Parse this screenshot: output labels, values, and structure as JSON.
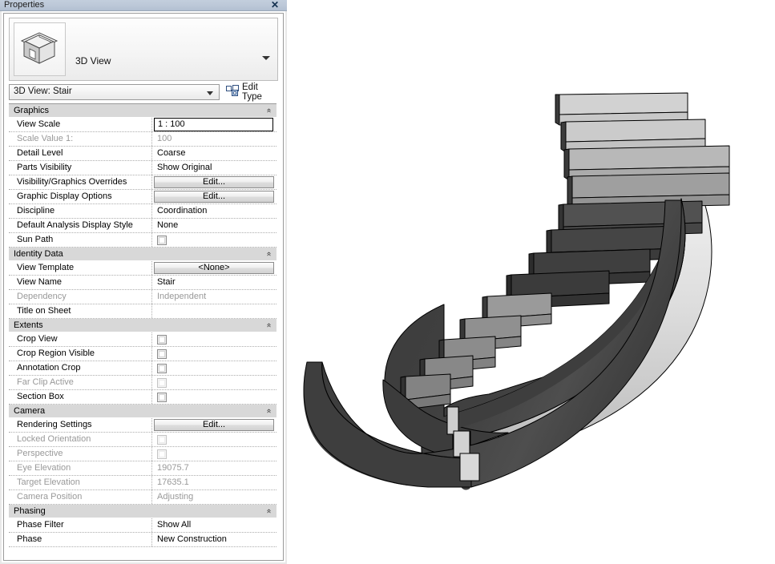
{
  "palette": {
    "title": "Properties",
    "close_icon": "close-icon",
    "type_thumbnail_icon": "house-3d-icon",
    "type_name": "3D View",
    "type_caret_icon": "chevron-down-icon",
    "type_selector_value": "3D View: Stair",
    "type_selector_arrow_icon": "chevron-down-icon",
    "edit_type_label": "Edit Type",
    "edit_type_icon": "edit-type-icon"
  },
  "sections": [
    {
      "name": "Graphics",
      "collapse_icon": "chevron-double-up-icon",
      "rows": [
        {
          "label": "View Scale",
          "type": "active-text",
          "value": "1 : 100",
          "disabled": false
        },
        {
          "label": "Scale Value    1:",
          "type": "text",
          "value": "100",
          "disabled": true
        },
        {
          "label": "Detail Level",
          "type": "text",
          "value": "Coarse",
          "disabled": false
        },
        {
          "label": "Parts Visibility",
          "type": "text",
          "value": "Show Original",
          "disabled": false
        },
        {
          "label": "Visibility/Graphics Overrides",
          "type": "button",
          "value": "Edit...",
          "disabled": false
        },
        {
          "label": "Graphic Display Options",
          "type": "button",
          "value": "Edit...",
          "disabled": false
        },
        {
          "label": "Discipline",
          "type": "text",
          "value": "Coordination",
          "disabled": false
        },
        {
          "label": "Default Analysis Display Style",
          "type": "text",
          "value": "None",
          "disabled": false
        },
        {
          "label": "Sun Path",
          "type": "checkbox",
          "value": "",
          "checked": false,
          "disabled": false
        }
      ]
    },
    {
      "name": "Identity Data",
      "collapse_icon": "chevron-double-up-icon",
      "rows": [
        {
          "label": "View Template",
          "type": "button",
          "value": "<None>",
          "disabled": false
        },
        {
          "label": "View Name",
          "type": "text",
          "value": "Stair",
          "disabled": false
        },
        {
          "label": "Dependency",
          "type": "text",
          "value": "Independent",
          "disabled": true
        },
        {
          "label": "Title on Sheet",
          "type": "text",
          "value": "",
          "disabled": false
        }
      ]
    },
    {
      "name": "Extents",
      "collapse_icon": "chevron-double-up-icon",
      "rows": [
        {
          "label": "Crop View",
          "type": "checkbox",
          "value": "",
          "checked": false,
          "disabled": false
        },
        {
          "label": "Crop Region Visible",
          "type": "checkbox",
          "value": "",
          "checked": false,
          "disabled": false
        },
        {
          "label": "Annotation Crop",
          "type": "checkbox",
          "value": "",
          "checked": false,
          "disabled": false
        },
        {
          "label": "Far Clip Active",
          "type": "checkbox",
          "value": "",
          "checked": false,
          "disabled": true
        },
        {
          "label": "Section Box",
          "type": "checkbox",
          "value": "",
          "checked": false,
          "disabled": false
        }
      ]
    },
    {
      "name": "Camera",
      "collapse_icon": "chevron-double-up-icon",
      "rows": [
        {
          "label": "Rendering Settings",
          "type": "button",
          "value": "Edit...",
          "disabled": false
        },
        {
          "label": "Locked Orientation",
          "type": "checkbox",
          "value": "",
          "checked": false,
          "disabled": true
        },
        {
          "label": "Perspective",
          "type": "checkbox",
          "value": "",
          "checked": false,
          "disabled": true
        },
        {
          "label": "Eye Elevation",
          "type": "text",
          "value": "19075.7",
          "disabled": true
        },
        {
          "label": "Target Elevation",
          "type": "text",
          "value": "17635.1",
          "disabled": true
        },
        {
          "label": "Camera Position",
          "type": "text",
          "value": "Adjusting",
          "disabled": true
        }
      ]
    },
    {
      "name": "Phasing",
      "collapse_icon": "chevron-double-up-icon",
      "rows": [
        {
          "label": "Phase Filter",
          "type": "text",
          "value": "Show All",
          "disabled": false
        },
        {
          "label": "Phase",
          "type": "text",
          "value": "New Construction",
          "disabled": false
        }
      ]
    }
  ],
  "viewport": {
    "model_name": "helical-stair-3d-model",
    "background": "#ffffff",
    "shading": {
      "tread_top_light": "#d4d4d4",
      "tread_top_mid": "#bdbdbd",
      "riser_dark": "#3a3a3a",
      "riser_mid": "#555555",
      "soffit_dark": "#3d3d3d",
      "outer_face_light": "#e2e2e2",
      "outline": "#000000"
    }
  }
}
